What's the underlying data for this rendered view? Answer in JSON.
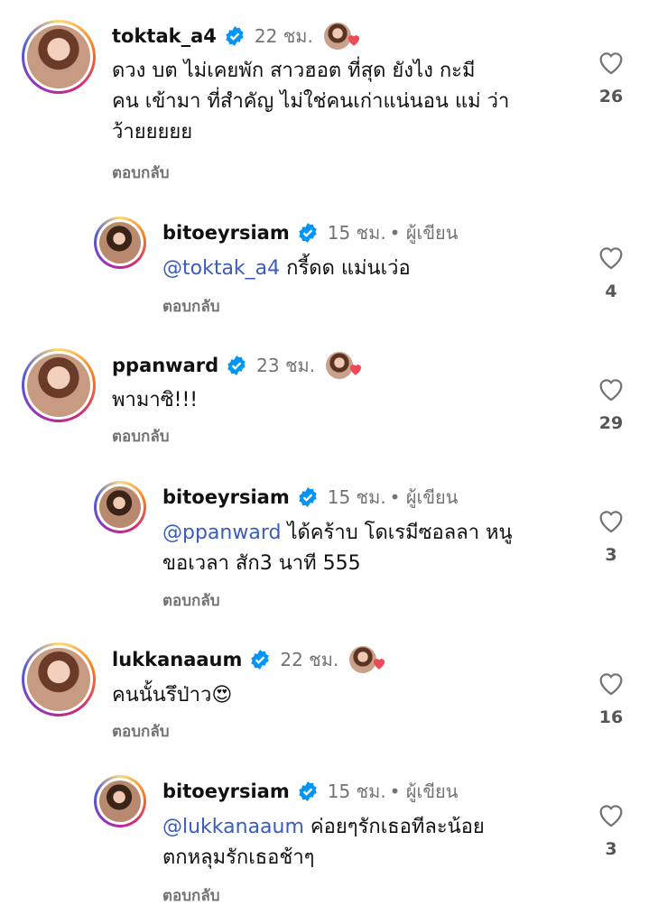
{
  "comments": [
    {
      "username": "toktak_a4",
      "time": "22 ชม.",
      "text_lines": [
        "ดวง บต ไม่เคยพัก สาวฮอต ที่สุด ยังไง กะมี",
        "คน เข้ามา ที่สำคัญ ไม่ใช่คนเก่าแน่นอน แม่ ว่า",
        "ว้ายยยยย"
      ],
      "reply_label": "ตอบกลับ",
      "likes": "26",
      "reply": {
        "username": "bitoeyrsiam",
        "time": "15 ชม.",
        "author_label": "• ผู้เขียน",
        "mention": "@toktak_a4",
        "text_lines": [
          "กรี้ดด แม่นเว่อ"
        ],
        "reply_label": "ตอบกลับ",
        "likes": "4"
      }
    },
    {
      "username": "ppanward",
      "time": "23 ชม.",
      "text_lines": [
        "พามาซิ!!!"
      ],
      "reply_label": "ตอบกลับ",
      "likes": "29",
      "reply": {
        "username": "bitoeyrsiam",
        "time": "15 ชม.",
        "author_label": "• ผู้เขียน",
        "mention": "@ppanward",
        "text_lines": [
          "ได้คร้าบ โดเรมีซอลลา หนู",
          "ขอเวลา สัก3 นาที 555"
        ],
        "reply_label": "ตอบกลับ",
        "likes": "3"
      }
    },
    {
      "username": "lukkanaaum",
      "time": "22 ชม.",
      "text_lines": [
        "คนนั้นรึป่าว😍"
      ],
      "reply_label": "ตอบกลับ",
      "likes": "16",
      "reply": {
        "username": "bitoeyrsiam",
        "time": "15 ชม.",
        "author_label": "• ผู้เขียน",
        "mention": "@lukkanaaum",
        "text_lines": [
          "ค่อยๆรักเธอทีละน้อย",
          "ตกหลุมรักเธอช้าๆ"
        ],
        "reply_label": "ตอบกลับ",
        "likes": "3"
      }
    }
  ],
  "colors": {
    "mention": "#3a5cbf",
    "verified": "#0095f6",
    "heart": "#ed4956",
    "muted": "#737373"
  },
  "icons": {
    "verified": "verified-badge-icon",
    "like": "heart-outline-icon",
    "liked_by_author": "author-liked-heart-icon"
  }
}
